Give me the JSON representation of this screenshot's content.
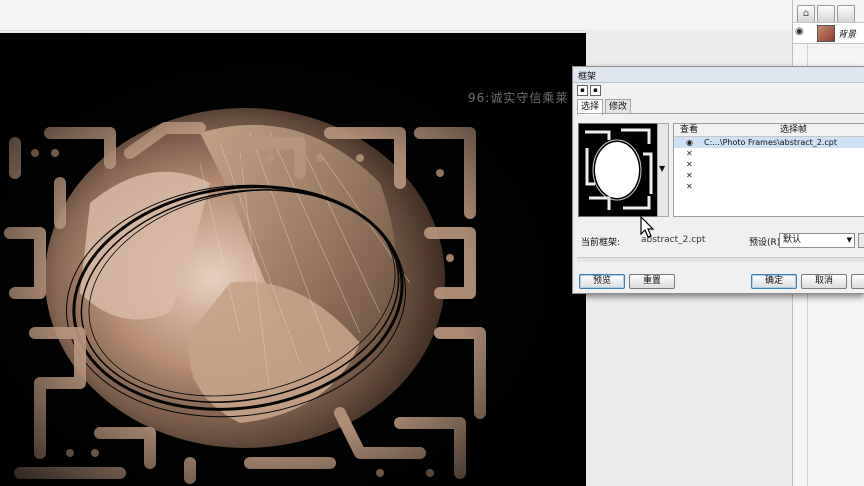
{
  "watermark": "96:诚实守信乘莱",
  "layers_panel": {
    "layer_name": "背景",
    "icons": [
      "lock-icon",
      "new-layer-icon",
      "delete-layer-icon",
      "eye-icon"
    ]
  },
  "dialog": {
    "title": "框架",
    "tabs": [
      "选择",
      "修改"
    ],
    "list": {
      "headers": {
        "view": "查看",
        "select": "选择帧"
      },
      "rows": [
        {
          "path": "C:...\\Photo Frames\\abstract_2.cpt",
          "selected": true
        },
        {
          "path": ""
        },
        {
          "path": ""
        },
        {
          "path": ""
        },
        {
          "path": ""
        }
      ]
    },
    "current_frame_label": "当前框架:",
    "current_frame_value": "abstract_2.cpt",
    "preset_label": "预设(R):",
    "preset_value": "默认",
    "buttons": {
      "preview": "预览",
      "reset": "重置",
      "ok": "确定",
      "cancel": "取消"
    }
  },
  "colors": {
    "canvas_bg": "#020202",
    "frame_tone": "#b8957c",
    "dialog_bg": "#f0f0f0",
    "selection": "#cfe1f5"
  }
}
